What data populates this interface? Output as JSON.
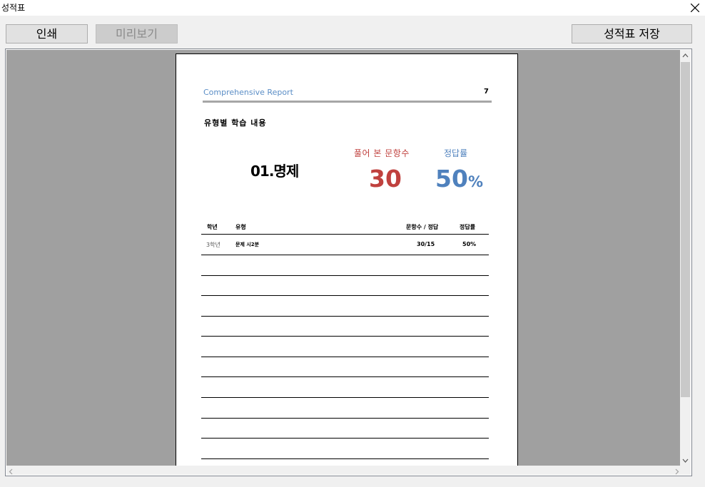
{
  "window": {
    "title": "성적표"
  },
  "toolbar": {
    "print_label": "인쇄",
    "preview_label": "미리보기",
    "save_label": "성적표 저장"
  },
  "report": {
    "header_title": "Comprehensive Report",
    "page_number": "7",
    "section_title": "유형별 학습 내용",
    "unit_name": "01.명제",
    "solved_label": "풀어 본 문항수",
    "solved_value": "30",
    "rate_label": "정답률",
    "rate_value": "50",
    "rate_unit": "%",
    "table": {
      "headers": {
        "grade": "학년",
        "type": "유형",
        "count": "문항수 / 정답",
        "rate": "정답률"
      },
      "rows": [
        {
          "grade": "3학년",
          "type": "문제 시2분",
          "count": "30/15",
          "rate": "50%"
        }
      ]
    }
  },
  "colors": {
    "report_blue": "#4f81bd",
    "report_red": "#c0413e",
    "viewer_bg": "#a0a0a0"
  }
}
